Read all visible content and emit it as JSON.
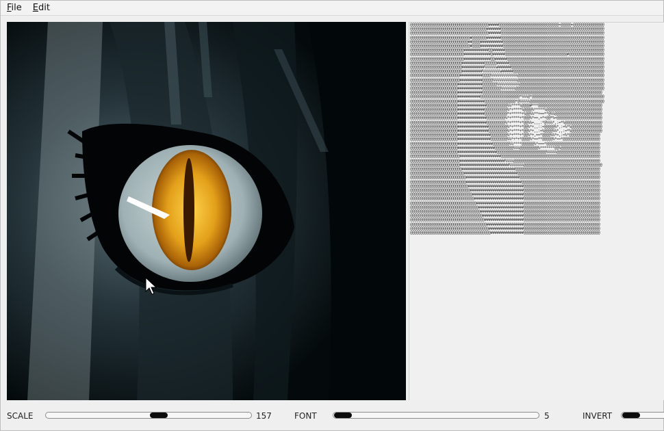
{
  "menu": {
    "items": [
      {
        "label": "File",
        "mnemonic": "F",
        "rest": "ile"
      },
      {
        "label": "Edit",
        "mnemonic": "E",
        "rest": "dit"
      }
    ]
  },
  "image_pane": {
    "description_icon": "anime-eye-image",
    "colors": {
      "iris": "#e3a01a",
      "pupil": "#3a1a00",
      "sclera": "#b8c6c8",
      "background": "#0b1418"
    }
  },
  "controls": {
    "scale": {
      "label": "SCALE",
      "value": "157",
      "position": 0.55
    },
    "font": {
      "label": "FONT",
      "value": "5",
      "position": 0.0
    },
    "invert": {
      "label": "INVERT",
      "position": 0.0
    }
  },
  "ascii_output": "@@@@@@@@@@@@@@@@@@@@@@@@@@@@@@@@@@@@@@#####@@@@@@@@@@@@@@@@@@@@@@@@@@@@@=@@@@@=@@@@@@@@@@@@@@@\n@@@@@@@@@@@@@@@@@@@@@@@@@@@@@@@@@@@@@#######@@@@@@@@@@@@@@@@@@@@@@@@@@@@@@@@@@@@@@@@@@@@@@@@@@\n@@@@@@@@@@@@@@@@@@@@@@@@@@@@@@@@@@@@@@######@@@@@@@@@@@@@@@@@@@@@@@@@@@@@@@@@@@@@@@@@@@@@@@@@@\n@@@@@@@@@@@@@@@@@@@@@@@@@@@@@#@@@@@@@#######@@@@@@@@@@@@@@@@@@@@@@@@@@@@@@@@@@@@@@@@@@@@@@@@@@\n@@@@@@@@@@@@@@@@@@@@@@@@@@@@##@@@@###########@@@@@@@@@@@@@@@@@@@@@@@@@@@@@@@@@@@@@@@@@@@@@@@@@\n@@@@@@@@@@@@@@@@@@@@@@@@@@@@@#@@@@###########@@@@@@@@@@@@@@@@@@@@@@@@@@@@@@@@@@@@@@@@@@@@@@@@@\n@@@@@@@@@@@@@@@@@@@@@@@@@@############@@######@@@@@@@@@@@@@@@@@@@@@@@@@@@@@@@@@@@@@@@@@@@@@@@@\n@@@@@@@@@@@@@@@@@@@@@@@@@@#############@######@@@@@@@@@@@@@@@@@@@@@@@@@@@@@@#@@@@@@@@@@@@@@@@@\n@@@@@@@@@@@@@@@@@@@@@@@@@@#############@@######@@@@@@@@@@@@@@@@@@@@@@@@@@@@@@@@@@@@@@@@@@@@@@@\n@@@@@@@@@@@@@@@@@@@@@@@@@###########@@@@@@######@@@@@@@@@@@@@@@@@@@@@@@@@@@@@@@@@@@@@@@@@@@@@@\n@@@@@@@@@@@@@@@@@@@@@@@@@###########%%%%%%#######@@@@@@@@@@@@@@@@@@@@@@@@@@@@@@@@@@@@@@@@@@@@@\n@@@@@@@@@@@@@@@@@@@@@@@@@##########%%%%%%%%%######@@@@@@@@@@@@@@@@@@@@@@@@@@@@@@@@@@@@@@@@@@@@\n@@@@@@@@@@@@@@@@@@@@@@@@###########@@@@%%%%%%%%%%%%%@@@@@@@@@@@@@@@@@@@@@@@@@@@@@@@@@@@@@@@@@@\n@@@@@@@@@@@@@@@@@@@@@@@@###########@@@@@%%%%%%%%%%%%@@@@@@@@@@@@@@@@@@@@@@@@@@@@@@@@@@@@@@@@@@\n@@@@@@@@@@@@@@@@@@@@@@@############@@@@@@@%%%%%%%%%%%@@@@@@@@@@@@@@@@@@@@@@@@@@@@@@@@@@@@@@@@@\n@@@@@@@@@@@@@@@@@@@@@@@############@@@@@@@@@%%%%%%%@@@@@@@@@@@@@@@@@@@@@@@@@@@@@@@@@@@@@@@@@@@\n@@@@@@@@@@@@@@@@@@@@@@@############@@@@@@@@@@@@@@@@@@@@@@@@@@@@@@@@@@@@@@@@@@@@@@@@@@@@@@@@@@\n@@@@@@@@@@@@@@@@@@@@@@@###########@@@@@@@@@@@@@@@@@@@*%%%@*@@@@@@@@@@@@@@@@@@@@@@@@@@@@@@@@@@@\n@@@@@@@@@@@@@@@@@@@@@@@#############@@@@@@@@@@@@@@@*@%%%%%@@@@@@@@@@@@@@@@@@@@@@@@@@@@@@@@@@@@\n@@@@@@@@@@@@@@@@@@@@@@@##############@@@@@@@@@@%%****%@@@@#***@@@@@@@@@@@@@@@@@@@@@@@@@@@@@@@\n@@@@@@@@@@@@@@@@@@@@@@@#############@@@@@@@@@@@%*+****%@@@@%*****%@@@@@@@@@@@@@@@@@@@@@@@@@@@\n@@@@@@@@@@@@@@@@@@@@@@@#############@@@@@@@@@@@*+*****+%@@%%**+==**@%%@@@@@@@@@@@@@@@@@@@@@@@\n@@@@@@@@@@@@@@@@@@@@@@@##############@@@@@@@@@%*+****+*@@@%*==,=*+@@*%=@@@@@@@@@@@@@@@@@@@@@@\n@@@@@@@@@@@@@@@@@@@@@@@##############@@@@@@@@@%*+****+*@@%%=,,,:*@%%%*,:=*%@@@@@@@@@@@@@@@@@@\n@@@@@@@@@@@@@@@@@@@@@@@###############@@@@@@@@@%*+***+*@@%*+,,::=@@@@@%*,:=%*%@@@@@@@@@@@@@@@\n@@@@@@@@@@@@@@@@@@@@@@@###############@@@@@@@@@%*+***+*@@%*+,,:=%@@@@%%*,,:=*%@@@@@@@@@@@@@@@\n@@@@@@@@@@@@@@@@@@@@@@@################@@@@@@@@%*+***+*@@%*+,==*@@@@%%*=,:=%*@@@@@@@@@@@@@@@\n@@@@@@@@@@@@@@@@@@@@@@@################@@@@@@@@%%*+*+*@@@@%*==**@@@@@%*==*@@@@@@@@@@@@@@@@@@\n@@@@@@@@@@@@@@@@@@@@@@@#################@@@@@@@@%%****@@@@@@%*===*@@@@@@@@@@@@@@@@@@@@@@@@@@\n@@@@@@@@@@@@@@@@@@@@@@@##################@@@@@@@@@%%%@@@@@@@@@%*******@@%@@@@@@@@@@@@@@@@@@@\n@@@@@@@@@@@@@@@@@@@@@@@###################@@@@@@@@@@@@@@@@@@@@@@@@%%%%%@@@@@@@@@@@@@@@@@@@@@\n@@@@@@@@@@@@@@@@@@@@@@@@####################@@@@@@@@@@@@@@@@@@@@@@@@@@@@@@@@@@@@@@@@@@@@@@@@\n@@@@@@@@@@@@@@@@@@@@@@@@######################%%%%@@@@@@@@@@@@@@@@@@@@@@@@@@@@@@@@@@@@@@@@@@\n@@@@@@@@@@@@@@@@@@@@@@@@########################%%%%%%%@@@@@@@@@@@@@@@@@@@@@@@@@@@@@@@@@@@@@@\n@@@@@@@@@@@@@@@@@@@@@@@@@##########################@@@@@@@@@@@@@@@@@@@@@@@@@@@@@@@@@@@@@@@@@\n@@@@@@@@@@@@@@@@@@@@@@@@@@##########################@@@@@@@@@@@@@@@@@@@@@@@@@@@@@@@@@@@@@@@@\n@@@@@@@@@@@@@@@@@@@@@@@@@@@##########################@@@@@@@@@@@@@@@@@@@@@@@@@@@@@@@@@@@@@@@\n@@@@@@@@@@@@@@@@@@@@@@@@@@@###########################@@@@@@@@@@@@@@@@@@@@@@@@@@@@@@@@@@@@@@\n@@@@@@@@@@@@@@@@@@@@@@@@@@@@###########################@@@@@@@@@@@@@@@@@@@@@@@@@@@@@@@@@@@@@\n@@@@@@@@@@@@@@@@@@@@@@@@@@@@@##########################@@@@@@@@@@@@@@@@@@@@@@@@@@@@@@@@@@@@@\n@@@@@@@@@@@@@@@@@@@@@@@@@@@@@@#########################@@@@@@@@@@@@@@@@@@@@@@@@@@@@@@@@@@@@@\n@@@@@@@@@@@@@@@@@@@@@@@@@@@@@@@########################@@@@@@@@@@@@@@@@@@@@@@@@@@@@@@@@@@@@@\n@@@@@@@@@@@@@@@@@@@@@@@@@@@@@@@@#######################@@@@@@@@@@@@@@@@@@@@@@@@@@@@@@@@@@@@@\n@@@@@@@@@@@@@@@@@@@@@@@@@@@@@@@@@######################@@@@@@@@@@@@@@@@@@@@@@@@@@@@@@@@@@@@@\n@@@@@@@@@@@@@@@@@@@@@@@@@@@@@@@@@@#####################@@@@@@@@@@@@@@@@@@@@@@@@@@@@@@@@@@@@@\n@@@@@@@@@@@@@@@@@@@@@@@@@@@@@@@@@@@####################@@@@@@@@@@@@@@@@@@@@@@@@@@@@@@@@@@@@@\n@@@@@@@@@@@@@@@@@@@@@@@@@@@@@@@@@@@@###################@@@@@@@@@@@@@@@@@@@@@@@@@@@@@@@@@@@@@\n@@@@@@@@@@@@@@@@@@@@@@@@@@@@@@@@@@@@@##################@@@@@@@@@@@@@@@@@@@@@@@@@@@@@@@@@@@@@\n@@@@@@@@@@@@@@@@@@@@@@@@@@@@@@@@@@@@@@#################@@@@@@@@@@@@@@@@@@@@@@@@@@@@@@@@@@@@@\n@@@@@@@@@@@@@@@@@@@@@@@@@@@@@@@@@@@@@@@################@@@@@@@@@@@@@@@@@@@@@@@@@@@@@@@@@@@@@"
}
